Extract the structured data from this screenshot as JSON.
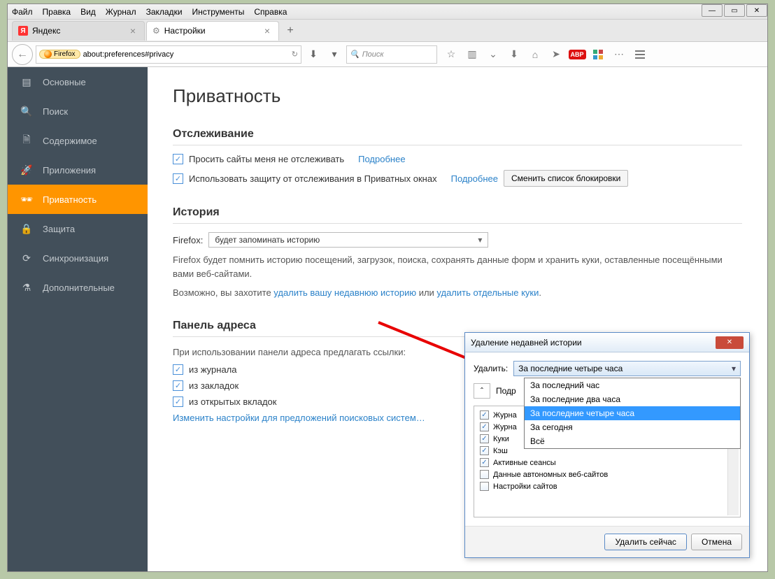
{
  "menubar": [
    "Файл",
    "Правка",
    "Вид",
    "Журнал",
    "Закладки",
    "Инструменты",
    "Справка"
  ],
  "tabs": [
    {
      "label": "Яндекс",
      "active": false
    },
    {
      "label": "Настройки",
      "active": true
    }
  ],
  "url_badge": "Firefox",
  "url": "about:preferences#privacy",
  "search_placeholder": "Поиск",
  "sidebar": {
    "items": [
      {
        "icon": "general",
        "label": "Основные"
      },
      {
        "icon": "search",
        "label": "Поиск"
      },
      {
        "icon": "content",
        "label": "Содержимое"
      },
      {
        "icon": "apps",
        "label": "Приложения"
      },
      {
        "icon": "privacy",
        "label": "Приватность",
        "active": true
      },
      {
        "icon": "security",
        "label": "Защита"
      },
      {
        "icon": "sync",
        "label": "Синхронизация"
      },
      {
        "icon": "advanced",
        "label": "Дополнительные"
      }
    ]
  },
  "page": {
    "title": "Приватность",
    "tracking": {
      "heading": "Отслеживание",
      "opt1": "Просить сайты меня не отслеживать",
      "opt1_more": "Подробнее",
      "opt2": "Использовать защиту от отслеживания в Приватных окнах",
      "opt2_more": "Подробнее",
      "opt2_btn": "Сменить список блокировки"
    },
    "history": {
      "heading": "История",
      "label": "Firefox:",
      "select": "будет запоминать историю",
      "desc": "Firefox будет помнить историю посещений, загрузок, поиска, сохранять данные форм и хранить куки, оставленные посещёнными вами веб-сайтами.",
      "maybe": "Возможно, вы захотите ",
      "link1": "удалить вашу недавнюю историю",
      "or": " или ",
      "link2": "удалить отдельные куки",
      "dot": "."
    },
    "addrbar": {
      "heading": "Панель адреса",
      "desc": "При использовании панели адреса предлагать ссылки:",
      "opt1": "из журнала",
      "opt2": "из закладок",
      "opt3": "из открытых вкладок",
      "link": "Изменить настройки для предложений поисковых систем…"
    }
  },
  "dialog": {
    "title": "Удаление недавней истории",
    "label": "Удалить:",
    "select_value": "За последние четыре часа",
    "options": [
      "За последний час",
      "За последние два часа",
      "За последние четыре часа",
      "За сегодня",
      "Всё"
    ],
    "details": "Подр",
    "items": [
      {
        "c": true,
        "label": "Журна"
      },
      {
        "c": true,
        "label": "Журна"
      },
      {
        "c": true,
        "label": "Куки"
      },
      {
        "c": true,
        "label": "Кэш"
      },
      {
        "c": true,
        "label": "Активные сеансы"
      },
      {
        "c": false,
        "label": "Данные автономных веб-сайтов"
      },
      {
        "c": false,
        "label": "Настройки сайтов"
      }
    ],
    "btn_ok": "Удалить сейчас",
    "btn_cancel": "Отмена"
  }
}
